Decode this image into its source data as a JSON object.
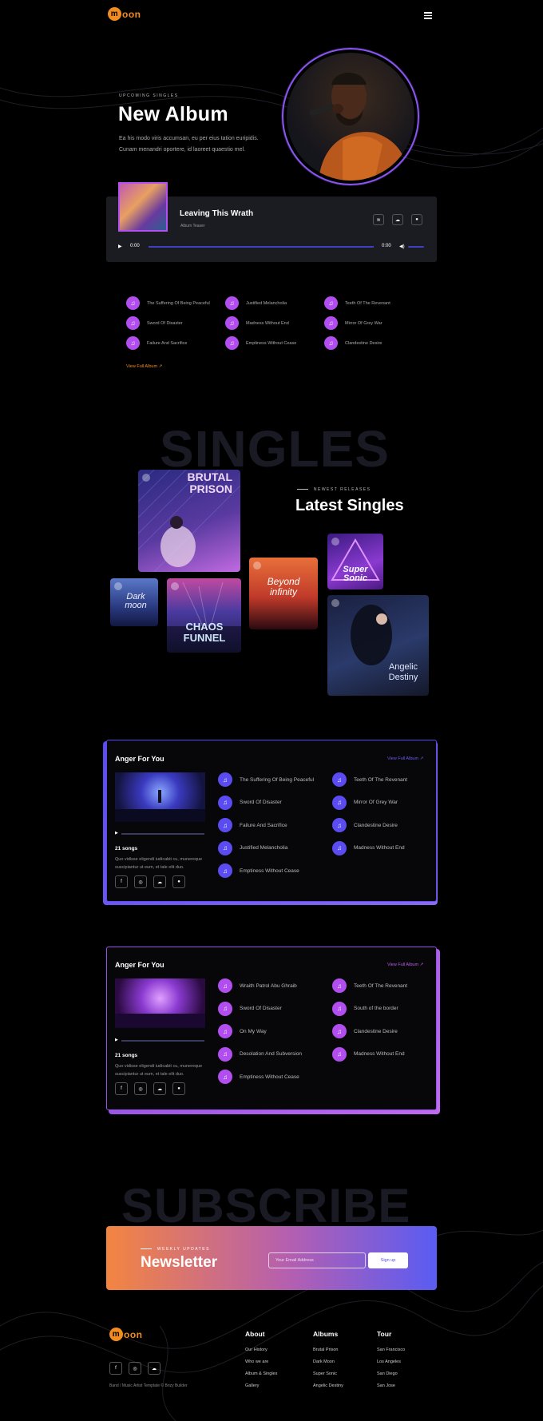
{
  "brand": {
    "logo_initial": "m",
    "logo_rest": "oon"
  },
  "hero": {
    "kicker": "UPCOMING SINGLES",
    "title": "New Album",
    "description_line1": "Ea his modo viris accumsan, eu per eius tation euripidis.",
    "description_line2": "Cunam menandri oportere, id laoreet quaestio mel."
  },
  "player": {
    "title": "Leaving This Wrath",
    "subtitle": "Album Teaser",
    "current_time": "0:00",
    "duration": "0:00",
    "progress": 0,
    "volume": 1.0
  },
  "album_tracks": [
    "The Suffering Of Being Peaceful",
    "Justified Melancholia",
    "Teeth Of The Revenant",
    "Sword Of Disaster",
    "Madness Without End",
    "Mirror Of Grey War",
    "Failure And Sacrifice",
    "Emptiness Without Cease",
    "Clandestine Desire"
  ],
  "view_full_album": "View Full Album",
  "singles": {
    "ghost": "SINGLES",
    "kicker": "NEWEST RELEASES",
    "title": "Latest Singles",
    "tiles": {
      "brutal": "BRUTAL PRISON",
      "dark": "Dark moon",
      "chaos": "CHAOS FUNNEL",
      "beyond": "Beyond infinity",
      "super": "Super Sonic",
      "angelic": "Angelic Destiny"
    }
  },
  "album_card_1": {
    "title": "Anger For You",
    "link": "View Full Album",
    "songs": "21 songs",
    "desc_line1": "Quo vidisse eligendi iudicabit cu, munereque",
    "desc_line2": "suscipiantur ut eum, et tale elit duo.",
    "accent": "#5a4cf0",
    "tracks": [
      "The Suffering Of Being Peaceful",
      "Teeth Of The Revenant",
      "Sword Of Disaster",
      "Mirror Of Grey War",
      "Failure And Sacrifice",
      "Clandestine Desire",
      "Justified Melancholia",
      "Madness Without End",
      "Emptiness Without Cease"
    ]
  },
  "album_card_2": {
    "title": "Anger For You",
    "link": "View Full Album",
    "songs": "21 songs",
    "desc_line1": "Quo vidisse eligendi iudicabit cu, munereque",
    "desc_line2": "suscipiantur ut eum, et tale elit duo.",
    "accent": "#b24ef0",
    "tracks": [
      "Wraith Patrol Abu Ghraib",
      "Teeth Of The Revenant",
      "Sword Of Disaster",
      "South of the border",
      "On My Way",
      "Clandestine Desire",
      "Desolation And Subversion",
      "Madness Without End",
      "Emptiness Without Cease"
    ]
  },
  "subscribe": {
    "ghost": "SUBSCRIBE",
    "kicker": "WEEKLY UPDATES",
    "title": "Newsletter",
    "placeholder": "Your Email Address",
    "button": "Sign up"
  },
  "footer": {
    "copyright": "Band / Music Artist Template © Brizy Builder",
    "columns": [
      {
        "title": "About",
        "links": [
          "Our History",
          "Who we are",
          "Album & Singles",
          "Gallery"
        ]
      },
      {
        "title": "Albums",
        "links": [
          "Brutal Prison",
          "Dark Moon",
          "Super Sonic",
          "Angelic Destiny"
        ]
      },
      {
        "title": "Tour",
        "links": [
          "San Francisco",
          "Los Angeles",
          "San Diego",
          "San Jose"
        ]
      }
    ]
  }
}
